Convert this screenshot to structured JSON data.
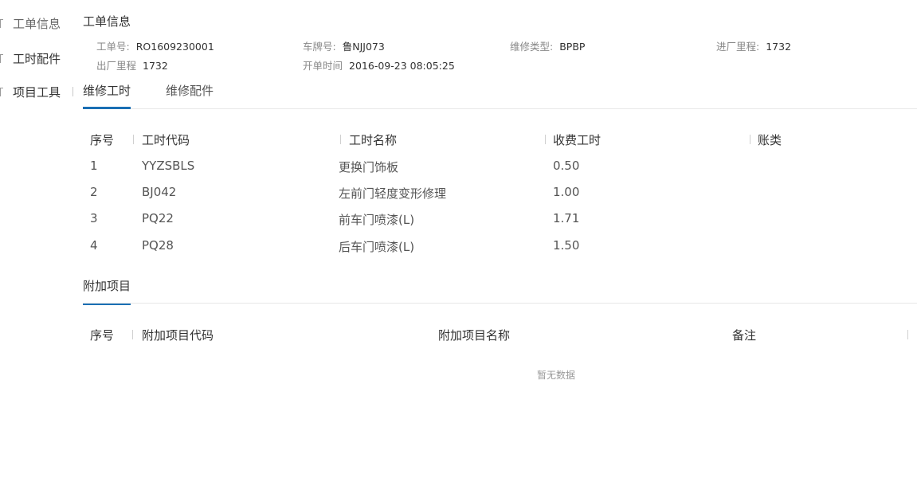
{
  "nav": {
    "items": [
      {
        "label": "工单信息"
      },
      {
        "label": "工时配件"
      },
      {
        "label": "项目工具"
      }
    ]
  },
  "order_info": {
    "title": "工单信息",
    "fields": [
      {
        "label": "工单号:",
        "value": "RO1609230001"
      },
      {
        "label": "车牌号:",
        "value": "鲁NJJ073"
      },
      {
        "label": "维修类型:",
        "value": "BPBP"
      },
      {
        "label": "进厂里程:",
        "value": "1732"
      },
      {
        "label": "出厂里程",
        "value": "1732"
      },
      {
        "label": "开单时间",
        "value": "2016-09-23 08:05:25"
      }
    ]
  },
  "tabs": [
    {
      "label": "维修工时",
      "active": true
    },
    {
      "label": "维修配件",
      "active": false
    }
  ],
  "labor_table": {
    "headers": [
      "序号",
      "工时代码",
      "工时名称",
      "收费工时",
      "账类"
    ],
    "rows": [
      {
        "no": "1",
        "code": "YYZSBLS",
        "name": "更换门饰板",
        "hours": "0.50",
        "account": ""
      },
      {
        "no": "2",
        "code": "BJ042",
        "name": "左前门轻度变形修理",
        "hours": "1.00",
        "account": ""
      },
      {
        "no": "3",
        "code": "PQ22",
        "name": "前车门喷漆(L)",
        "hours": "1.71",
        "account": ""
      },
      {
        "no": "4",
        "code": "PQ28",
        "name": "后车门喷漆(L)",
        "hours": "1.50",
        "account": ""
      }
    ]
  },
  "extra_section": {
    "tab_label": "附加项目",
    "headers": [
      "序号",
      "附加项目代码",
      "附加项目名称",
      "备注"
    ],
    "empty_text": "暂无数据"
  },
  "colors": {
    "accent": "#1a6fb4"
  }
}
